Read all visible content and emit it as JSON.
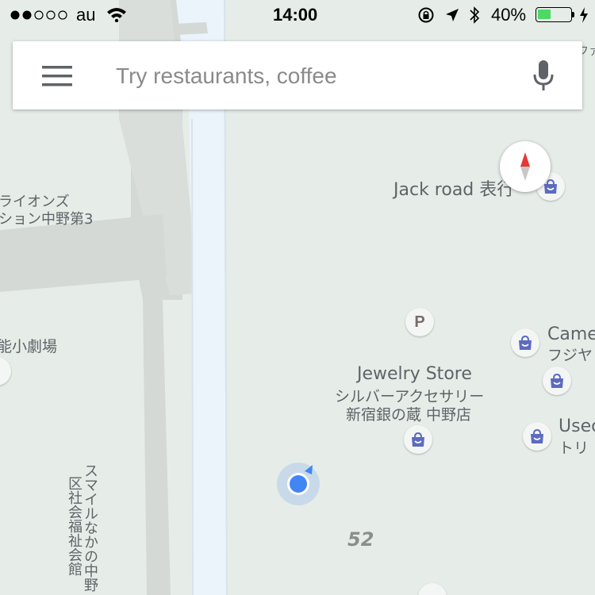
{
  "status_bar": {
    "carrier": "au",
    "time": "14:00",
    "battery_percent": "40%",
    "battery_level": 0.4,
    "battery_color": "#4cd964",
    "signal_bars_filled": 2,
    "signal_bars_total": 5
  },
  "search": {
    "placeholder": "Try restaurants, coffee",
    "menu_icon": "hamburger-menu-icon",
    "voice_icon": "microphone-icon"
  },
  "compass": {
    "icon": "compass-icon",
    "north_color": "#e53935"
  },
  "map": {
    "background_color": "#e6ede8",
    "road_color": "#d4d9d6",
    "canal_color": "#ebf3fb",
    "current_location_color": "#4285f4",
    "labels": {
      "jack_road": "Jack road 表行",
      "lions_1": "ライオンズ",
      "lions_2": "ション中野第3",
      "theater": "能小劇場",
      "jewelry_en": "Jewelry Store",
      "jewelry_jp1": "シルバーアクセサリー",
      "jewelry_jp2": "新宿銀の蔵 中野店",
      "camera_en": "Came",
      "camera_jp": "フジヤ",
      "used_en": "Usec",
      "used_jp": "トリ",
      "smile_1": "スマイルなかの中野",
      "smile_2": "区社会福祉会館",
      "top_right_partial": "ファ",
      "block_number": "52"
    },
    "parking_letter": "P",
    "shopping_bag_icon": "shopping-bag-icon",
    "shopping_bag_color": "#5c6bc0"
  }
}
